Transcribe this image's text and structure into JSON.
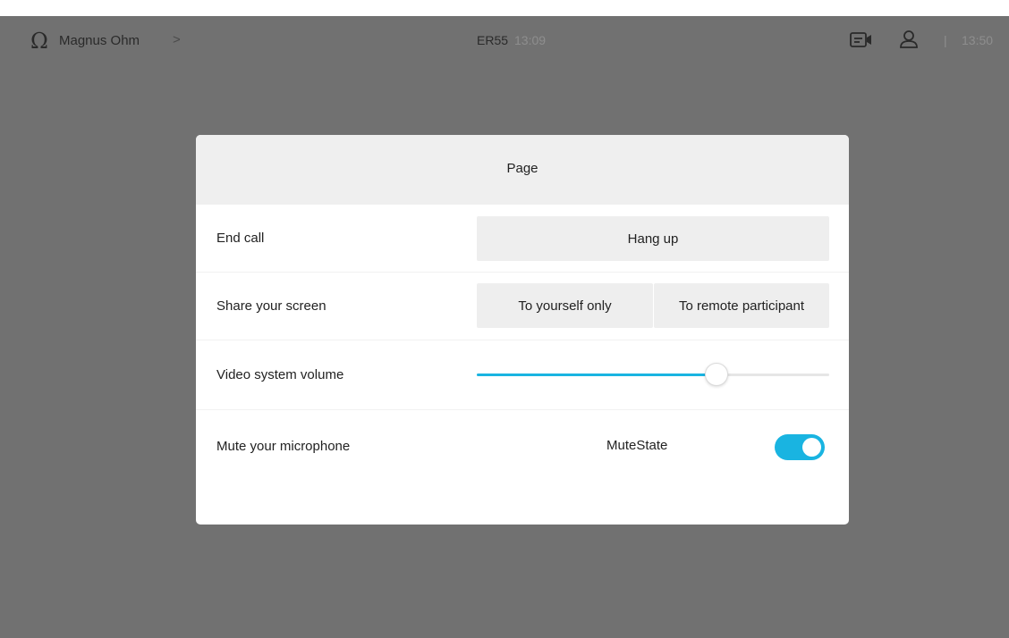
{
  "topbar": {
    "user_name": "Magnus Ohm",
    "chevron": ">",
    "room_name": "ER55",
    "room_time": "13:09",
    "divider": "|",
    "clock": "13:50",
    "icons": {
      "left": "omega-icon",
      "camera": "camera-icon",
      "person": "person-icon"
    }
  },
  "dialog": {
    "title": "Page",
    "rows": [
      {
        "label": "End call",
        "button": "Hang up"
      },
      {
        "label": "Share your screen",
        "buttons": [
          "To yourself only",
          "To remote participant"
        ]
      },
      {
        "label": "Video system volume",
        "volume": 0.68
      },
      {
        "label": "Mute your microphone",
        "toggle_text": "MuteState",
        "toggle_on": true
      }
    ]
  },
  "colors": {
    "accent": "#19b4e1",
    "backdrop": "#717171",
    "header": "#efefef",
    "button": "#eeeeee"
  }
}
